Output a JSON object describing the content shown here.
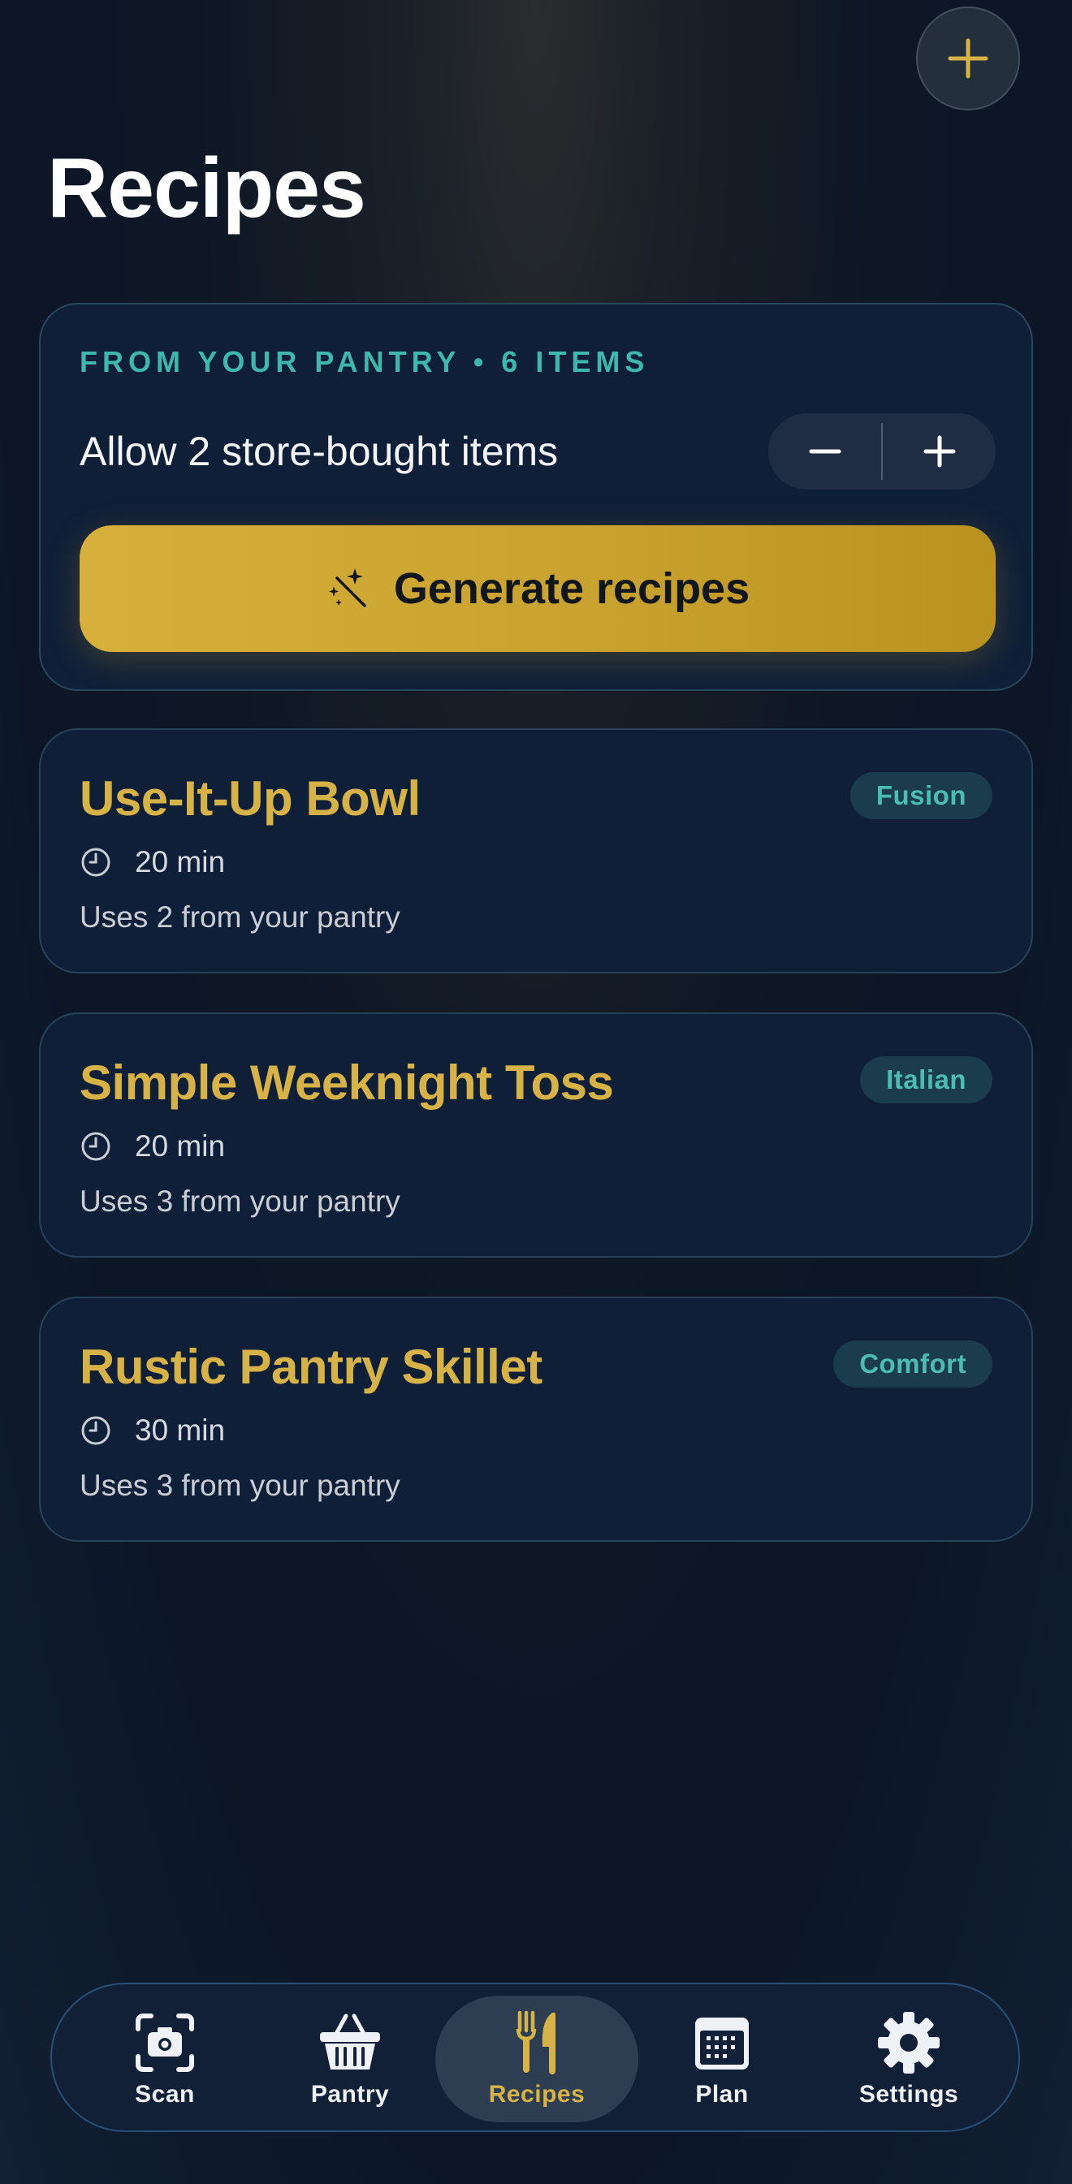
{
  "header": {
    "title": "Recipes",
    "add_icon": "plus-icon"
  },
  "pantry_card": {
    "header": "FROM YOUR PANTRY • 6 ITEMS",
    "allow_label": "Allow 2 store-bought items",
    "store_bought_allowed": 2,
    "pantry_item_count": 6,
    "decrement_icon": "minus-icon",
    "increment_icon": "plus-icon",
    "generate_label": "Generate recipes",
    "generate_icon": "magic-wand-icon"
  },
  "recipes": [
    {
      "title": "Use-It-Up Bowl",
      "badge": "Fusion",
      "time": "20 min",
      "uses": "Uses 2 from your pantry"
    },
    {
      "title": "Simple Weeknight Toss",
      "badge": "Italian",
      "time": "20 min",
      "uses": "Uses 3 from your pantry"
    },
    {
      "title": "Rustic Pantry Skillet",
      "badge": "Comfort",
      "time": "30 min",
      "uses": "Uses 3 from your pantry"
    }
  ],
  "nav": {
    "items": [
      {
        "label": "Scan",
        "icon": "camera-scan-icon",
        "active": false
      },
      {
        "label": "Pantry",
        "icon": "basket-icon",
        "active": false
      },
      {
        "label": "Recipes",
        "icon": "fork-knife-icon",
        "active": true
      },
      {
        "label": "Plan",
        "icon": "calendar-icon",
        "active": false
      },
      {
        "label": "Settings",
        "icon": "gear-icon",
        "active": false
      }
    ]
  },
  "colors": {
    "accent_gold": "#d7b246",
    "accent_teal": "#3fb6ae",
    "card_bg": "#0f1f38",
    "badge_bg": "#1a3c4c"
  }
}
